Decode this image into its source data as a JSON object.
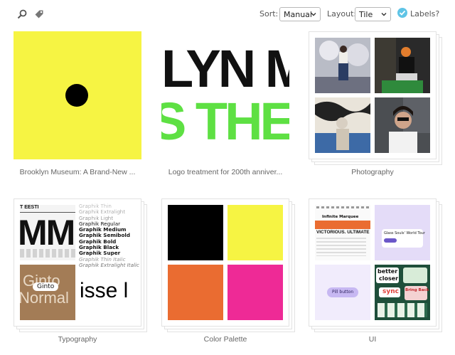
{
  "toolbar": {
    "sort_label": "Sort:",
    "sort_value": "Manual",
    "layout_label": "Layout:",
    "layout_value": "Tile",
    "labels_toggle": "Labels?"
  },
  "collections": [
    {
      "title": "Brooklyn Museum: A Brand-New ..."
    },
    {
      "title": "Logo treatment for 200th anniver...",
      "logo_top": "LYN M",
      "logo_bottom": "S THE S"
    },
    {
      "title": "Photography"
    },
    {
      "title": "Typography",
      "head_text": "T EESTI",
      "big_text": "MM",
      "weights": [
        "Graphik Thin",
        "Graphik Extralight",
        "Graphik Light",
        "Graphik Regular",
        "Graphik Medium",
        "Graphik Semibold",
        "Graphik Bold",
        "Graphik Black",
        "Graphik Super",
        "Graphik Thin Italic",
        "Graphik Extralight Italic"
      ],
      "ginto_big": "Ginto",
      "normal_big": "Normal",
      "ginto_chip": "Ginto",
      "isse_text": "isse l"
    },
    {
      "title": "Color Palette",
      "colors": [
        "#000000",
        "#f6f443",
        "#ea6c31",
        "#ee2a96"
      ]
    },
    {
      "title": "UI",
      "marquee_title": "Infinite Marquee",
      "marquee_text": "VICTORIOUS. ULTIMATE",
      "tour_text": "Glass Souls' World Tour",
      "pill_text": "Pill button",
      "sticker_1": "better",
      "sticker_2": "closer",
      "sticker_3": "sync",
      "sticker_4": "Bring Back"
    }
  ],
  "colors": {
    "accent": "#5fc4e6",
    "yellow": "#f6f443",
    "green": "#5ee043"
  }
}
